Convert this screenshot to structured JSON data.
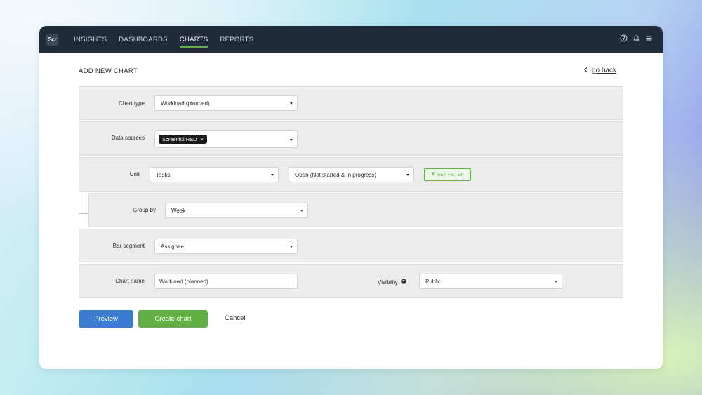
{
  "app": {
    "logo_text": "Scr"
  },
  "nav": {
    "items": [
      {
        "label": "INSIGHTS",
        "active": false
      },
      {
        "label": "DASHBOARDS",
        "active": false
      },
      {
        "label": "CHARTS",
        "active": true
      },
      {
        "label": "REPORTS",
        "active": false
      }
    ],
    "icons": [
      "help-icon",
      "bell-icon",
      "menu-icon"
    ]
  },
  "page": {
    "title": "ADD NEW CHART",
    "back_label": "go back"
  },
  "form": {
    "chart_type": {
      "label": "Chart type",
      "value": "Workload (planned)"
    },
    "data_sources": {
      "label": "Data sources",
      "tag": "Screenful R&D",
      "tag_remove": "×"
    },
    "unit": {
      "label": "Unit",
      "value": "Tasks",
      "state_value": "Open (Not started & In progress)",
      "filter_button": "SET FILTER"
    },
    "group_by": {
      "label": "Group by",
      "value": "Week"
    },
    "bar_segment": {
      "label": "Bar segment",
      "value": "Assignee"
    },
    "chart_name": {
      "label": "Chart name",
      "value": "Workload (planned)"
    },
    "visibility": {
      "label": "Visibility",
      "value": "Public"
    }
  },
  "actions": {
    "preview": "Preview",
    "create": "Create chart",
    "cancel": "Cancel"
  },
  "colors": {
    "topbar": "#1f2b3a",
    "preview": "#3a7ccf",
    "create": "#62b043",
    "accent": "#5fb048"
  }
}
